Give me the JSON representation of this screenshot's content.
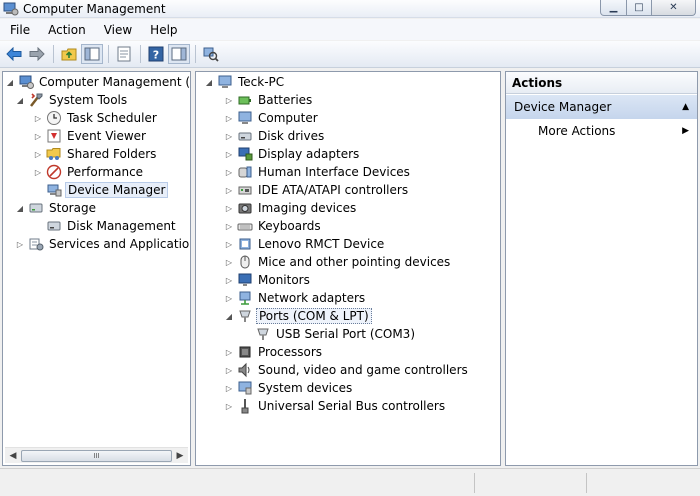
{
  "window": {
    "title": "Computer Management"
  },
  "menu": [
    "File",
    "Action",
    "View",
    "Help"
  ],
  "toolbar": [
    "back-icon",
    "forward-icon",
    "up-folder-icon",
    "show-hide-tree-icon",
    "properties-icon",
    "help-icon",
    "show-hide-action-pane-icon",
    "scan-hardware-icon"
  ],
  "left_tree": {
    "root": "Computer Management (Local",
    "system_tools": "System Tools",
    "task_scheduler": "Task Scheduler",
    "event_viewer": "Event Viewer",
    "shared_folders": "Shared Folders",
    "performance": "Performance",
    "device_manager": "Device Manager",
    "storage": "Storage",
    "disk_management": "Disk Management",
    "services": "Services and Applications"
  },
  "devices": {
    "computer": "Teck-PC",
    "categories": [
      "Batteries",
      "Computer",
      "Disk drives",
      "Display adapters",
      "Human Interface Devices",
      "IDE ATA/ATAPI controllers",
      "Imaging devices",
      "Keyboards",
      "Lenovo RMCT Device",
      "Mice and other pointing devices",
      "Monitors",
      "Network adapters",
      "Ports (COM & LPT)",
      "USB Serial Port (COM3)",
      "Processors",
      "Sound, video and game controllers",
      "System devices",
      "Universal Serial Bus controllers"
    ]
  },
  "actions": {
    "header": "Actions",
    "section": "Device Manager",
    "more": "More Actions"
  },
  "scroll_glyph": "III"
}
